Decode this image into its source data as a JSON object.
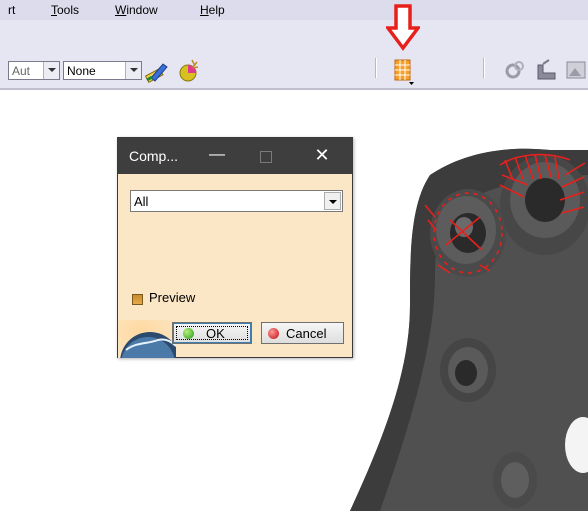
{
  "menubar": {
    "items": [
      {
        "label": "rt",
        "accel": ""
      },
      {
        "label": "ools",
        "accel": "T"
      },
      {
        "label": "indow",
        "accel": "W"
      },
      {
        "label": "elp",
        "accel": "H"
      }
    ]
  },
  "toolbar": {
    "combo1_value": "Aut",
    "combo2_value": "None",
    "icons": [
      "paintbrush-icon",
      "material-icon",
      "compass-table-icon",
      "gear-icon",
      "analysis-icon",
      "image-icon"
    ]
  },
  "annotation": {
    "arrow_color": "#e8201c"
  },
  "dialog": {
    "title": "Comp...",
    "minimize": "—",
    "close": "✕",
    "filter_value": "All",
    "preview_label": "Preview",
    "ok_label": "OK",
    "cancel_label": "Cancel"
  },
  "colors": {
    "dialog_bg": "#fbe6c6",
    "titlebar": "#3e3e3e",
    "part": "#4a4a4a",
    "highlight": "#e8201c"
  }
}
